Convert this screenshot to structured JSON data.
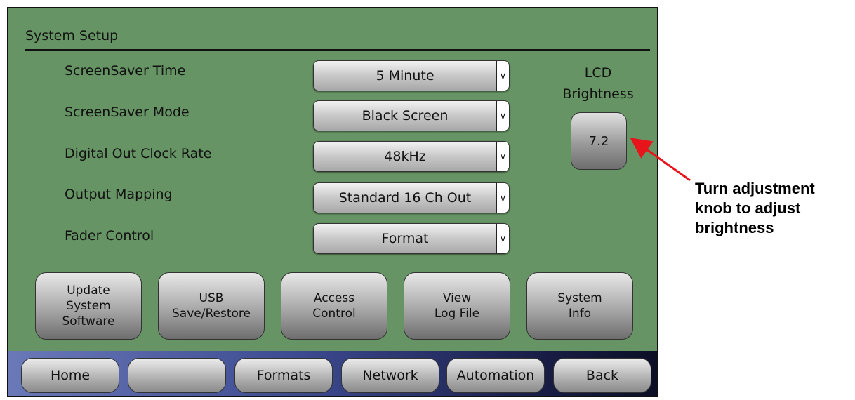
{
  "title": "System Setup",
  "settings": [
    {
      "label": "ScreenSaver Time",
      "value": "5 Minute"
    },
    {
      "label": "ScreenSaver Mode",
      "value": "Black Screen"
    },
    {
      "label": "Digital Out Clock Rate",
      "value": "48kHz"
    },
    {
      "label": "Output Mapping",
      "value": "Standard 16 Ch Out"
    },
    {
      "label": "Fader Control",
      "value": "Format"
    }
  ],
  "dropdown_arrow": "v",
  "lcd": {
    "label_line1": "LCD",
    "label_line2": "Brightness",
    "value": "7.2"
  },
  "buttons": [
    {
      "label": "Update\nSystem\nSoftware"
    },
    {
      "label": "USB\nSave/Restore"
    },
    {
      "label": "Access\nControl"
    },
    {
      "label": "View\nLog File"
    },
    {
      "label": "System\nInfo"
    }
  ],
  "nav": [
    {
      "label": "Home"
    },
    {
      "label": ""
    },
    {
      "label": "Formats"
    },
    {
      "label": "Network"
    },
    {
      "label": "Automation"
    },
    {
      "label": "Back"
    }
  ],
  "callout": "Turn adjustment knob to adjust brightness",
  "colors": {
    "screen": "#669464",
    "arrow": "#e8141b",
    "navbar": "#3c4a90"
  }
}
